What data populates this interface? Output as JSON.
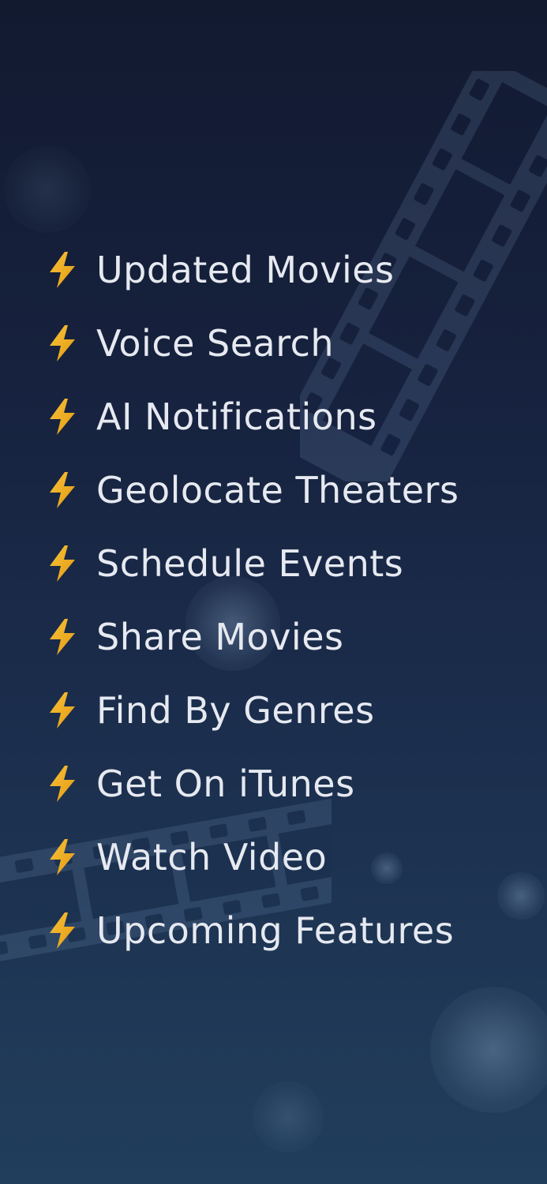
{
  "features": [
    {
      "label": "Updated Movies",
      "icon": "lightning-bolt-icon"
    },
    {
      "label": "Voice Search",
      "icon": "lightning-bolt-icon"
    },
    {
      "label": "AI Notifications",
      "icon": "lightning-bolt-icon"
    },
    {
      "label": "Geolocate Theaters",
      "icon": "lightning-bolt-icon"
    },
    {
      "label": "Schedule Events",
      "icon": "lightning-bolt-icon"
    },
    {
      "label": "Share Movies",
      "icon": "lightning-bolt-icon"
    },
    {
      "label": "Find By Genres",
      "icon": "lightning-bolt-icon"
    },
    {
      "label": "Get On iTunes",
      "icon": "lightning-bolt-icon"
    },
    {
      "label": "Watch Video",
      "icon": "lightning-bolt-icon"
    },
    {
      "label": "Upcoming Features",
      "icon": "lightning-bolt-icon"
    }
  ],
  "colors": {
    "background_top": "#121a30",
    "background_bottom": "#213e5c",
    "text": "#e6e9f0",
    "bolt_light": "#f7c23a",
    "bolt_dark": "#e39a12"
  }
}
